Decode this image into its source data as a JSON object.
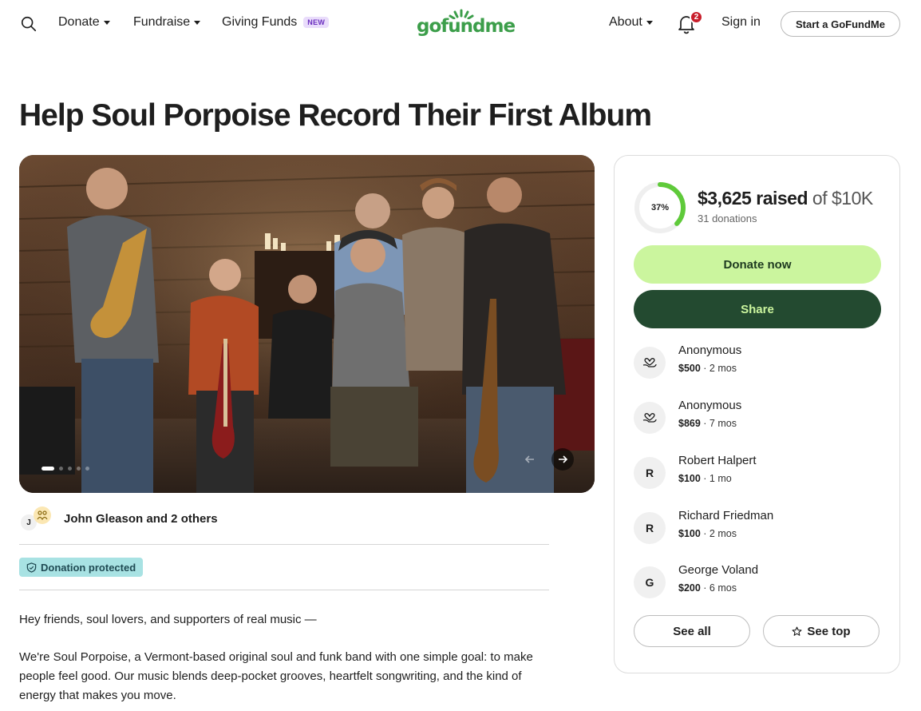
{
  "nav": {
    "donate": "Donate",
    "fundraise": "Fundraise",
    "giving_funds": "Giving Funds",
    "new_badge": "NEW",
    "logo": "gofundme",
    "about": "About",
    "notification_count": "2",
    "sign_in": "Sign in",
    "start": "Start a GoFundMe"
  },
  "campaign": {
    "title": "Help Soul Porpoise Record Their First Album",
    "organizer_initial": "J",
    "organizer": "John Gleason and 2 others",
    "protected": "Donation protected",
    "story": [
      "Hey friends, soul lovers, and supporters of real music —",
      "We're Soul Porpoise, a Vermont-based original soul and funk band with one simple goal: to make people feel good. Our music blends deep-pocket grooves, heartfelt songwriting, and the kind of energy that makes you move."
    ]
  },
  "progress": {
    "percent_label": "37%",
    "fraction": 0.37,
    "raised": "$3,625 raised",
    "of": "of",
    "goal": "$10K",
    "donations": "31 donations",
    "ring_color": "#5fca3a"
  },
  "buttons": {
    "donate": "Donate now",
    "share": "Share",
    "see_all": "See all",
    "see_top": "See top"
  },
  "donors": [
    {
      "avatar": "",
      "icon": "heart-hand-icon",
      "name": "Anonymous",
      "amount": "$500",
      "time": "· 2 mos"
    },
    {
      "avatar": "",
      "icon": "heart-hand-icon",
      "name": "Anonymous",
      "amount": "$869",
      "time": "· 7 mos"
    },
    {
      "avatar": "R",
      "icon": "",
      "name": "Robert Halpert",
      "amount": "$100",
      "time": "· 1 mo"
    },
    {
      "avatar": "R",
      "icon": "",
      "name": "Richard Friedman",
      "amount": "$100",
      "time": "· 2 mos"
    },
    {
      "avatar": "G",
      "icon": "",
      "name": "George Voland",
      "amount": "$200",
      "time": "· 6 mos"
    }
  ],
  "colors": {
    "brand_green": "#3c9e4a",
    "donate_bg": "#cbf59e",
    "share_bg": "#234a30",
    "protected_bg": "#a8e2e3"
  }
}
